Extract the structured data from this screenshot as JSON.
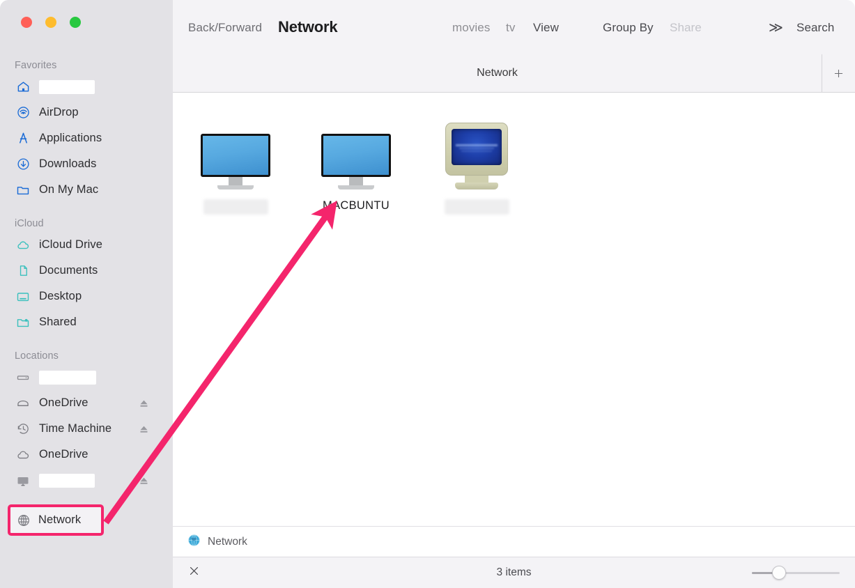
{
  "window": {
    "traffic_lights": [
      {
        "name": "close",
        "color": "#ff5f57"
      },
      {
        "name": "minimize",
        "color": "#febc2e"
      },
      {
        "name": "zoom",
        "color": "#28c840"
      }
    ]
  },
  "toolbar": {
    "back_forward_label": "Back/Forward",
    "title": "Network",
    "movies_label": "movies",
    "tv_label": "tv",
    "view_label": "View",
    "group_by_label": "Group By",
    "share_label": "Share",
    "overflow_label": "≫",
    "search_label": "Search"
  },
  "tabbar": {
    "active_tab": "Network",
    "add_tab_label": "+"
  },
  "sidebar": {
    "sections": [
      {
        "title": "Favorites",
        "items": [
          {
            "label": "",
            "icon": "home-icon",
            "redacted": true
          },
          {
            "label": "AirDrop",
            "icon": "airdrop-icon",
            "redacted": false
          },
          {
            "label": "Applications",
            "icon": "applications-icon",
            "redacted": false
          },
          {
            "label": "Downloads",
            "icon": "downloads-icon",
            "redacted": false
          },
          {
            "label": "On My Mac",
            "icon": "folder-icon",
            "redacted": false
          }
        ]
      },
      {
        "title": "iCloud",
        "items": [
          {
            "label": "iCloud Drive",
            "icon": "cloud-icon",
            "redacted": false
          },
          {
            "label": "Documents",
            "icon": "document-icon",
            "redacted": false
          },
          {
            "label": "Desktop",
            "icon": "desktop-icon",
            "redacted": false
          },
          {
            "label": "Shared",
            "icon": "shared-folder-icon",
            "redacted": false
          }
        ]
      },
      {
        "title": "Locations",
        "items": [
          {
            "label": "",
            "icon": "harddisk-icon",
            "redacted": true,
            "eject": false
          },
          {
            "label": "OneDrive",
            "icon": "external-drive-icon",
            "redacted": false,
            "eject": true
          },
          {
            "label": "Time Machine",
            "icon": "time-machine-icon",
            "redacted": false,
            "eject": true
          },
          {
            "label": "OneDrive",
            "icon": "cloud-icon",
            "redacted": false,
            "eject": false
          },
          {
            "label": "",
            "icon": "display-icon",
            "redacted": true,
            "eject": true
          }
        ]
      }
    ],
    "network_item": {
      "label": "Network",
      "icon": "globe-icon",
      "highlighted": true,
      "highlight_color": "#f4256c"
    }
  },
  "content": {
    "items": [
      {
        "label": "",
        "icon": "lcd-display-icon",
        "redacted": true
      },
      {
        "label": "MACBUNTU",
        "icon": "lcd-display-icon",
        "redacted": false
      },
      {
        "label": "",
        "icon": "crt-monitor-icon",
        "redacted": true
      }
    ]
  },
  "pathbar": {
    "icon": "network-globe-icon",
    "label": "Network"
  },
  "statusbar": {
    "close_label": "✕",
    "item_count": "3 items",
    "zoom_slider_value": 27
  },
  "annotation": {
    "arrow_color": "#f4256c"
  }
}
